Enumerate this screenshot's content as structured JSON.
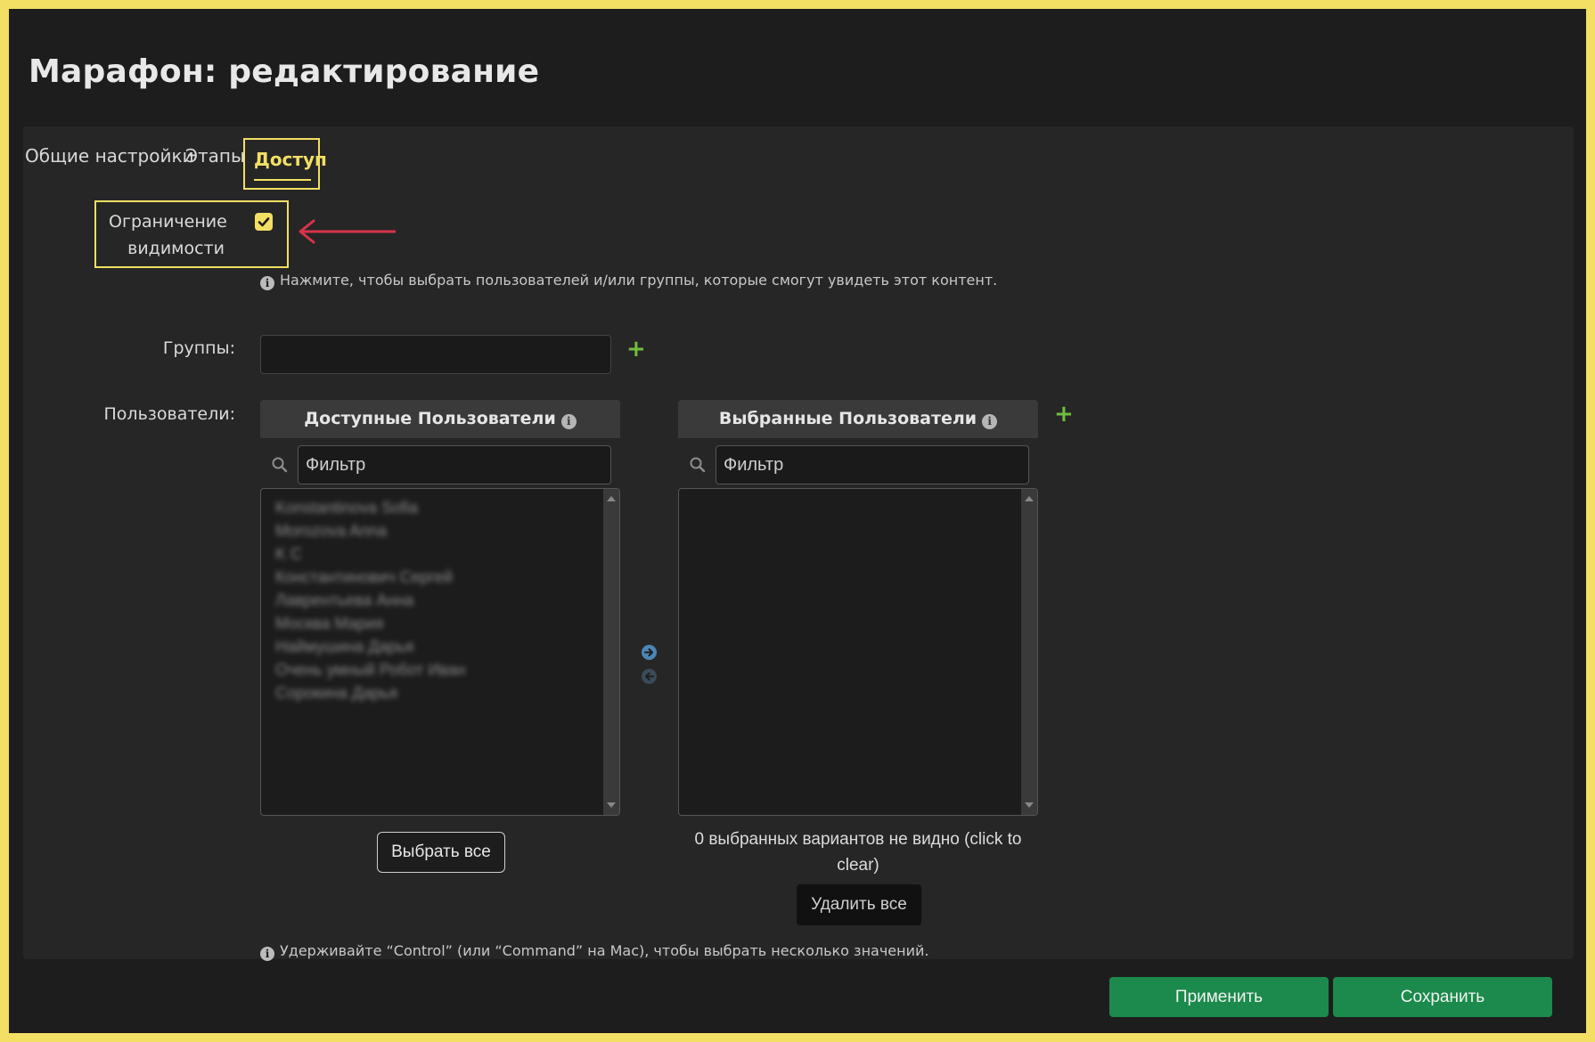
{
  "page": {
    "title": "Марафон: редактирование"
  },
  "tabs": [
    {
      "label": "Общие настройки"
    },
    {
      "label": "Этапы"
    },
    {
      "label": "Доступ",
      "active": true
    }
  ],
  "visibility": {
    "label": "Ограничение видимости",
    "checked": true
  },
  "hints": {
    "select_users": "Нажмите, чтобы выбрать пользователей и/или группы, которые смогут увидеть этот контент.",
    "multi_select": "Удерживайте “Control” (или “Command” на Mac), чтобы выбрать несколько значений."
  },
  "groups": {
    "label": "Группы:",
    "value": ""
  },
  "users": {
    "label": "Пользователи:",
    "available": {
      "title": "Доступные Пользователи",
      "filter_placeholder": "Фильтр",
      "items": [
        "Konstantinova Sofia",
        "Morozova Anna",
        "K C",
        "Константинович Сергей",
        "Лаврентьева Анна",
        "Москва Мария",
        "Наймушина Дарья",
        "Очень умный Робот Иван",
        "Сорокина Дарья"
      ],
      "select_all_label": "Выбрать все"
    },
    "chosen": {
      "title": "Выбранные Пользователи",
      "filter_placeholder": "Фильтр",
      "items": [],
      "hidden_note": "0 выбранных вариантов не видно (click to clear)",
      "remove_all_label": "Удалить все"
    }
  },
  "actions": {
    "apply_label": "Применить",
    "save_label": "Сохранить"
  },
  "icons": {
    "info": "info-icon",
    "add": "plus-icon",
    "search": "search-icon",
    "move_right": "arrow-right-circle-icon",
    "move_left": "arrow-left-circle-icon",
    "annotation": "red-arrow-icon"
  },
  "colors": {
    "highlight": "#f2df63",
    "accent_green": "#1b8a4c",
    "add_green": "#6fbf3e",
    "annotation_red": "#d8334a",
    "background": "#1d1d1d"
  }
}
